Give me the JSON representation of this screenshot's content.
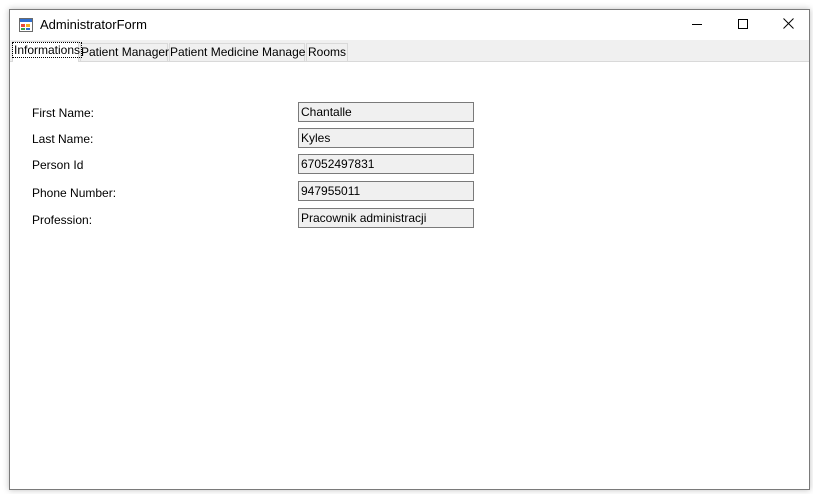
{
  "window": {
    "title": "AdministratorForm"
  },
  "tabs": [
    {
      "label": "Informations",
      "active": true
    },
    {
      "label": "Patient Manager",
      "active": false
    },
    {
      "label": "Patient Medicine Manager",
      "active": false
    },
    {
      "label": "Rooms",
      "active": false
    }
  ],
  "form": {
    "first_name_label": "First Name:",
    "first_name_value": "Chantalle",
    "last_name_label": "Last Name:",
    "last_name_value": "Kyles",
    "person_id_label": "Person Id",
    "person_id_value": "67052497831",
    "phone_label": "Phone Number:",
    "phone_value": "947955011",
    "profession_label": "Profession:",
    "profession_value": "Pracownik administracji"
  },
  "icons": {
    "app": "window-form-icon",
    "minimize": "minimize-icon",
    "maximize": "maximize-icon",
    "close": "close-icon"
  },
  "colors": {
    "tabstrip_bg": "#f0f0f0",
    "field_bg": "#f0f0f0",
    "field_border": "#7a7a7a"
  }
}
